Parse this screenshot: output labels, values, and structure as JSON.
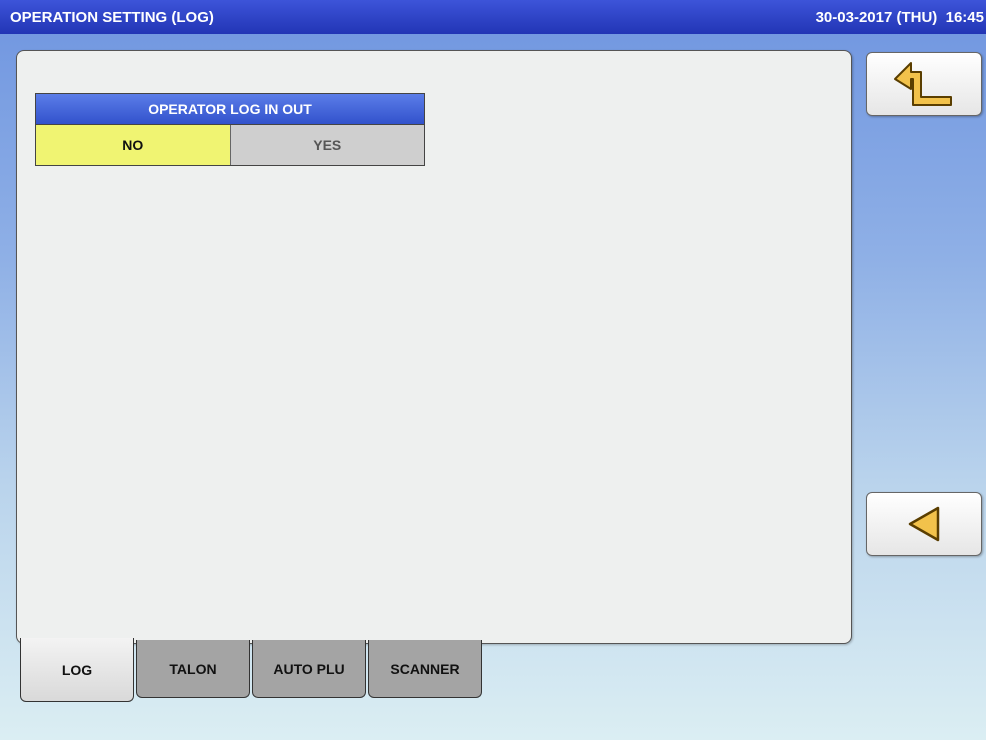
{
  "header": {
    "title": "OPERATION SETTING (LOG)",
    "datetime": "30-03-2017 (THU)  16:45"
  },
  "setting": {
    "title": "OPERATOR LOG IN OUT",
    "options": [
      "NO",
      "YES"
    ],
    "selected": "NO"
  },
  "side_buttons": {
    "back_icon": "return-arrow-icon",
    "prev_icon": "triangle-left-icon"
  },
  "tabs": [
    "LOG",
    "TALON",
    "AUTO PLU",
    "SCANNER"
  ],
  "active_tab": "LOG",
  "colors": {
    "titlebar": "#2235b5",
    "selected_option": "#f0f472",
    "icon_fill": "#f2c24b"
  }
}
